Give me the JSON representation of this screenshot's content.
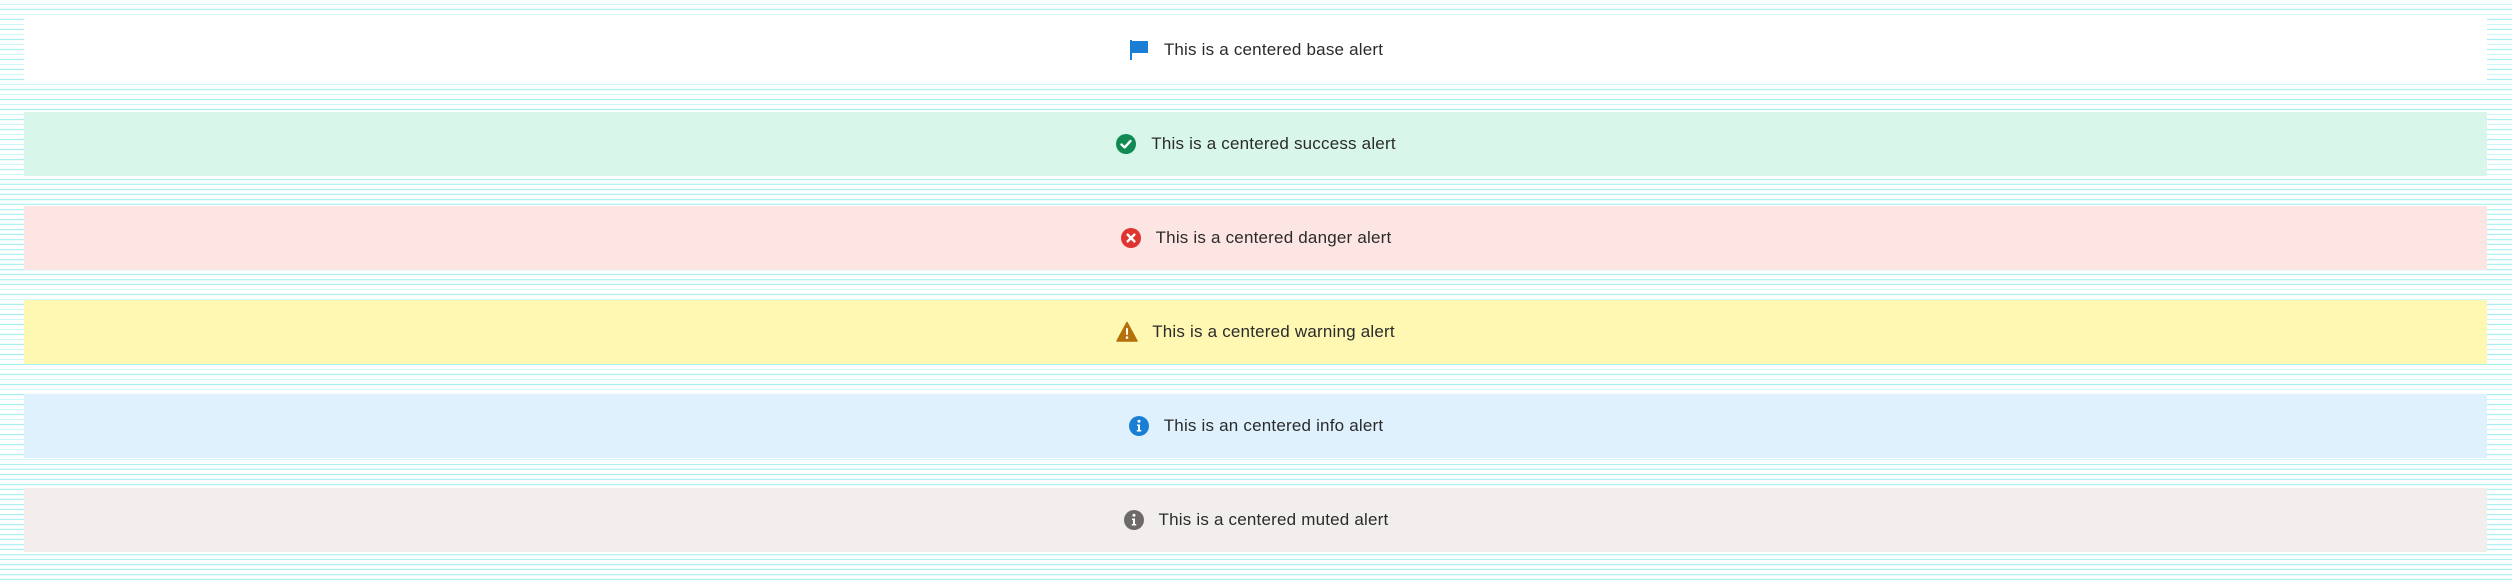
{
  "alerts": [
    {
      "id": "base",
      "icon": "flag-icon",
      "text": "This is a centered base alert",
      "bg": "#ffffff",
      "icon_color": "#1a7fd4"
    },
    {
      "id": "success",
      "icon": "check-circle-icon",
      "text": "This is a centered success alert",
      "bg": "#d8f7ea",
      "icon_color": "#0f8a52"
    },
    {
      "id": "danger",
      "icon": "x-circle-icon",
      "text": "This is a centered danger alert",
      "bg": "#fde5e4",
      "icon_color": "#e0342e"
    },
    {
      "id": "warning",
      "icon": "warning-triangle-icon",
      "text": "This is a centered warning alert",
      "bg": "#fff8b3",
      "icon_color": "#b5700a"
    },
    {
      "id": "info",
      "icon": "info-circle-icon",
      "text": "This is an centered info alert",
      "bg": "#def1fd",
      "icon_color": "#1a7fd4"
    },
    {
      "id": "muted",
      "icon": "info-circle-icon",
      "text": "This is a centered muted alert",
      "bg": "#f2eeee",
      "icon_color": "#6e6a6a"
    }
  ]
}
